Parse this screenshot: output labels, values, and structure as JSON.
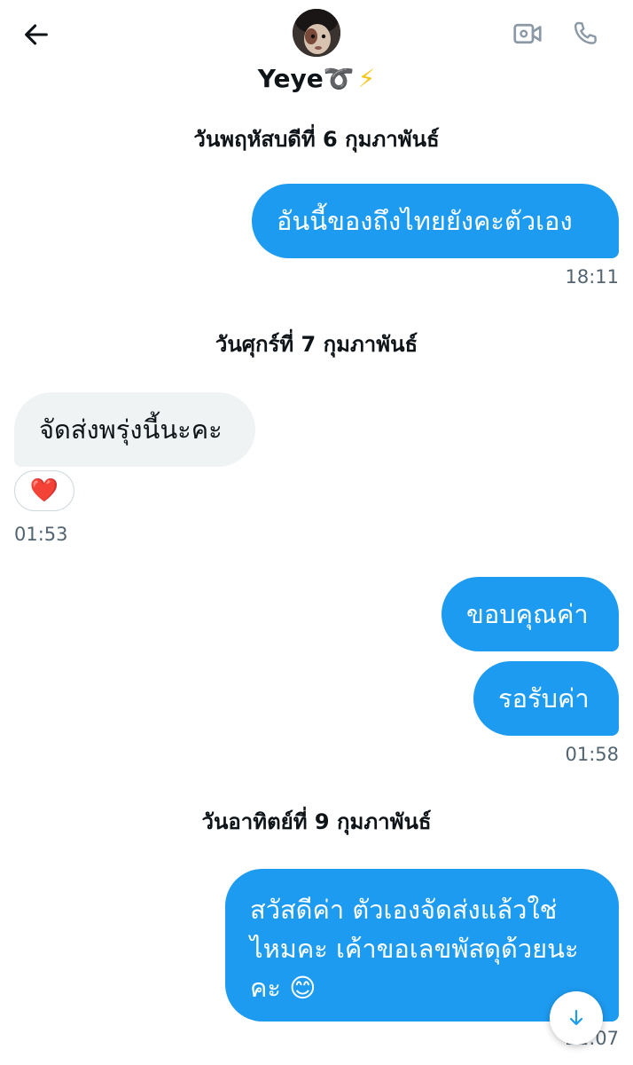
{
  "header": {
    "contact_name": "Yeye➰",
    "name_emoji": "⚡",
    "icons": [
      "back-arrow-icon",
      "video-call-icon",
      "phone-call-icon"
    ]
  },
  "dates": {
    "d1": "วันพฤหัสบดีที่ 6 กุมภาพันธ์",
    "d2": "วันศุกร์ที่ 7 กุมภาพันธ์",
    "d3": "วันอาทิตย์ที่ 9 กุมภาพันธ์"
  },
  "messages": [
    {
      "direction": "out",
      "text": "อันนี้ของถึงไทยยังคะตัวเอง",
      "time": "18:11"
    },
    {
      "direction": "in",
      "text": "จัดส่งพรุ่งนี้นะคะ",
      "reaction": "❤️",
      "time": "01:53"
    },
    {
      "direction": "out",
      "text": "ขอบคุณค่า"
    },
    {
      "direction": "out",
      "text": "รอรับค่า",
      "time": "01:58"
    },
    {
      "direction": "out",
      "lines": [
        "สวัสดีค่า ตัวเองจัดส่งแล้วใช่",
        "ไหมคะ เค้าขอเลขพัสดุด้วยนะ",
        "คะ 😊"
      ],
      "time": "22:07"
    }
  ],
  "colors": {
    "outgoing_bubble": "#1d9bf0",
    "incoming_bubble": "#eff3f4",
    "time_text": "#536471"
  }
}
